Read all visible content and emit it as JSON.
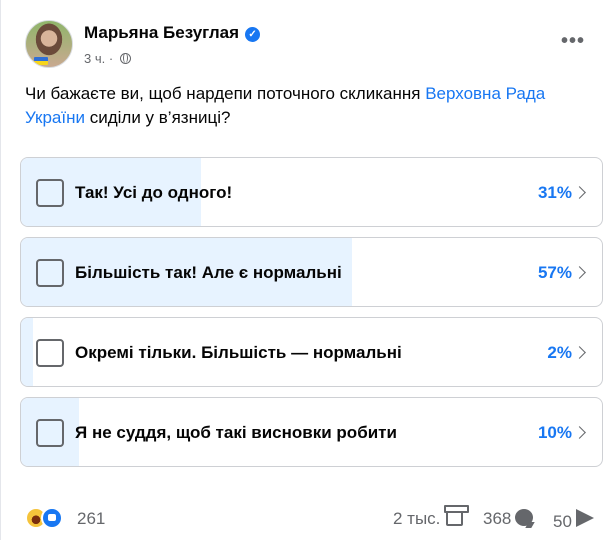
{
  "post": {
    "author": "Марьяна Безуглая",
    "time": "3 ч.",
    "separator": "·",
    "question_before": "Чи бажаєте ви, щоб нардепи поточного скликання ",
    "question_link": "Верховна Рада України",
    "question_after": " сиділи у в’язниці?"
  },
  "poll": {
    "options": [
      {
        "label": "Так! Усі до одного!",
        "percent": "31%",
        "value": 31
      },
      {
        "label": "Більшість так! Але є нормальні",
        "percent": "57%",
        "value": 57
      },
      {
        "label": "Окремі тільки. Більшість — нормальні",
        "percent": "2%",
        "value": 2
      },
      {
        "label": "Я не суддя, щоб такі висновки робити",
        "percent": "10%",
        "value": 10
      }
    ]
  },
  "footer": {
    "reactions": "261",
    "views": "2 тыс.",
    "comments": "368",
    "shares": "50"
  },
  "colors": {
    "accent": "#1877f2",
    "fill": "#e7f3ff",
    "muted": "#65676b"
  },
  "icons": [
    "verified-badge-icon",
    "globe-icon",
    "more-icon",
    "checkbox-icon",
    "chevron-right-icon",
    "haha-reaction-icon",
    "like-reaction-icon",
    "views-icon",
    "comment-icon",
    "share-icon"
  ]
}
